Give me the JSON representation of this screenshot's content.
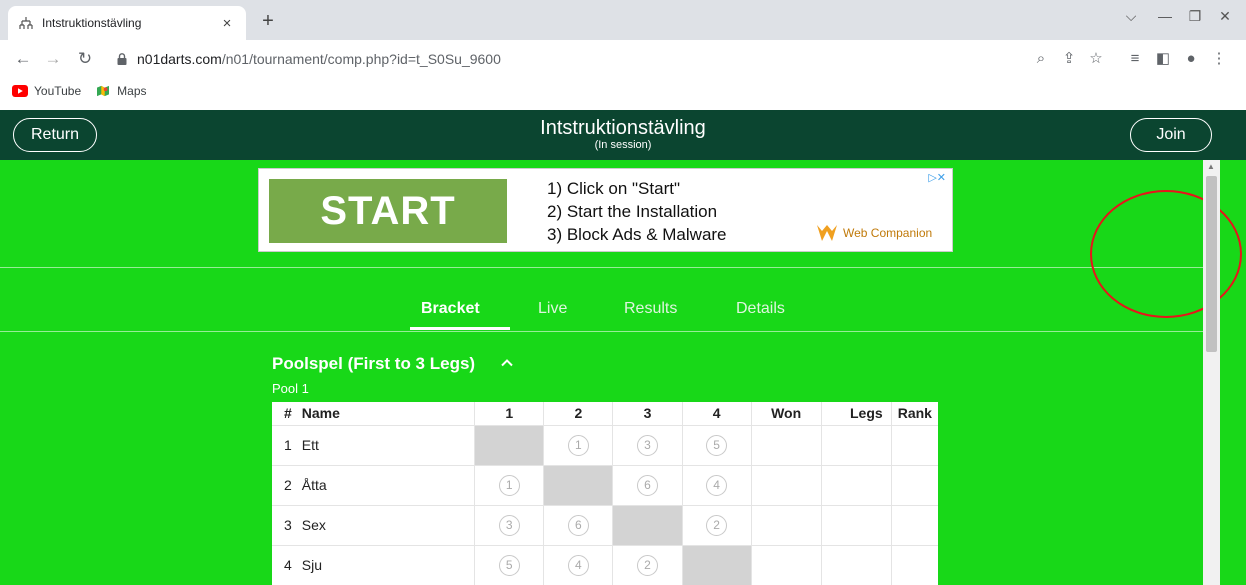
{
  "browser": {
    "tab_title": "Intstruktionstävling",
    "tab_close": "×",
    "new_tab": "+",
    "url_host": "n01darts.com",
    "url_path": "/n01/tournament/comp.php?id=t_S0Su_9600",
    "bookmarks": [
      {
        "label": "YouTube",
        "icon": "youtube-icon"
      },
      {
        "label": "Maps",
        "icon": "maps-icon"
      }
    ]
  },
  "header": {
    "return_label": "Return",
    "join_label": "Join",
    "title": "Intstruktionstävling",
    "subtitle": "(In session)"
  },
  "ad": {
    "start_label": "START",
    "steps": [
      "1) Click on \"Start\"",
      "2) Start the Installation",
      "3) Block Ads & Malware"
    ],
    "brand": "Web Companion",
    "choice": "▷✕"
  },
  "tabs": [
    {
      "label": "Bracket",
      "active": true
    },
    {
      "label": "Live",
      "active": false
    },
    {
      "label": "Results",
      "active": false
    },
    {
      "label": "Details",
      "active": false
    }
  ],
  "pool": {
    "title": "Poolspel (First to 3 Legs)",
    "subtitle": "Pool 1",
    "columns": [
      "#",
      "Name",
      "1",
      "2",
      "3",
      "4",
      "Won",
      "Legs",
      "Rank"
    ],
    "rows": [
      {
        "num": "1",
        "name": "Ett",
        "games": [
          "",
          "1",
          "3",
          "5"
        ]
      },
      {
        "num": "2",
        "name": "Åtta",
        "games": [
          "1",
          "",
          "6",
          "4"
        ]
      },
      {
        "num": "3",
        "name": "Sex",
        "games": [
          "3",
          "6",
          "",
          "2"
        ]
      },
      {
        "num": "4",
        "name": "Sju",
        "games": [
          "5",
          "4",
          "2",
          ""
        ]
      }
    ]
  },
  "colors": {
    "page_green": "#18d818",
    "header_green": "#0b4530",
    "annotation_red": "#e8141b"
  }
}
